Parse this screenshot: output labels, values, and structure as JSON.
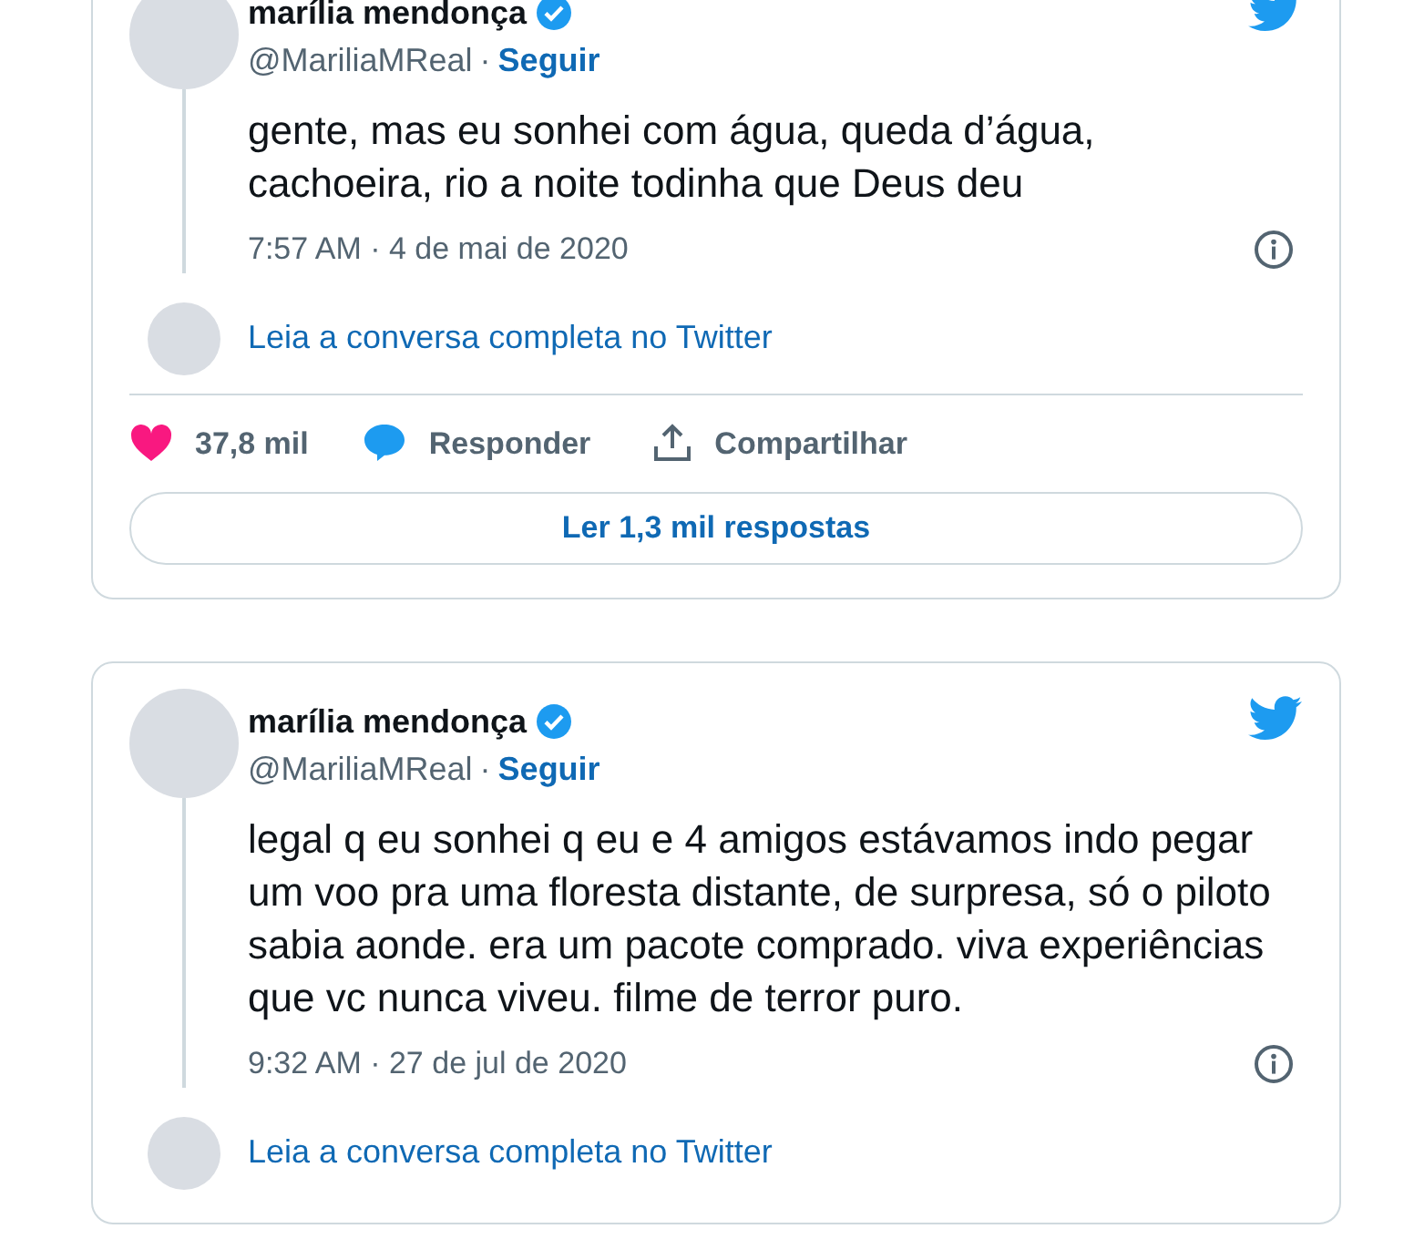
{
  "tweets": [
    {
      "name": "marília mendonça",
      "verified": true,
      "handle": "@MariliaMReal",
      "separator": "·",
      "follow": "Seguir",
      "text": "gente, mas eu sonhei com água, queda d’água, cachoeira, rio a noite todinha que Deus deu",
      "time": "7:57 AM · 4 de mai de 2020",
      "read_link": "Leia a conversa completa no Twitter",
      "likes": "37,8 mil",
      "reply": "Responder",
      "share": "Compartilhar",
      "read_replies": "Ler 1,3 mil respostas"
    },
    {
      "name": "marília mendonça",
      "verified": true,
      "handle": "@MariliaMReal",
      "separator": "·",
      "follow": "Seguir",
      "text": "legal q eu sonhei q eu e 4 amigos estávamos indo pegar um voo pra uma floresta distante, de surpresa, só o piloto sabia aonde. era um pacote comprado. viva experiências que vc nunca viveu. filme de terror puro.",
      "time": "9:32 AM · 27 de jul de 2020",
      "read_link": "Leia a conversa completa no Twitter"
    }
  ]
}
